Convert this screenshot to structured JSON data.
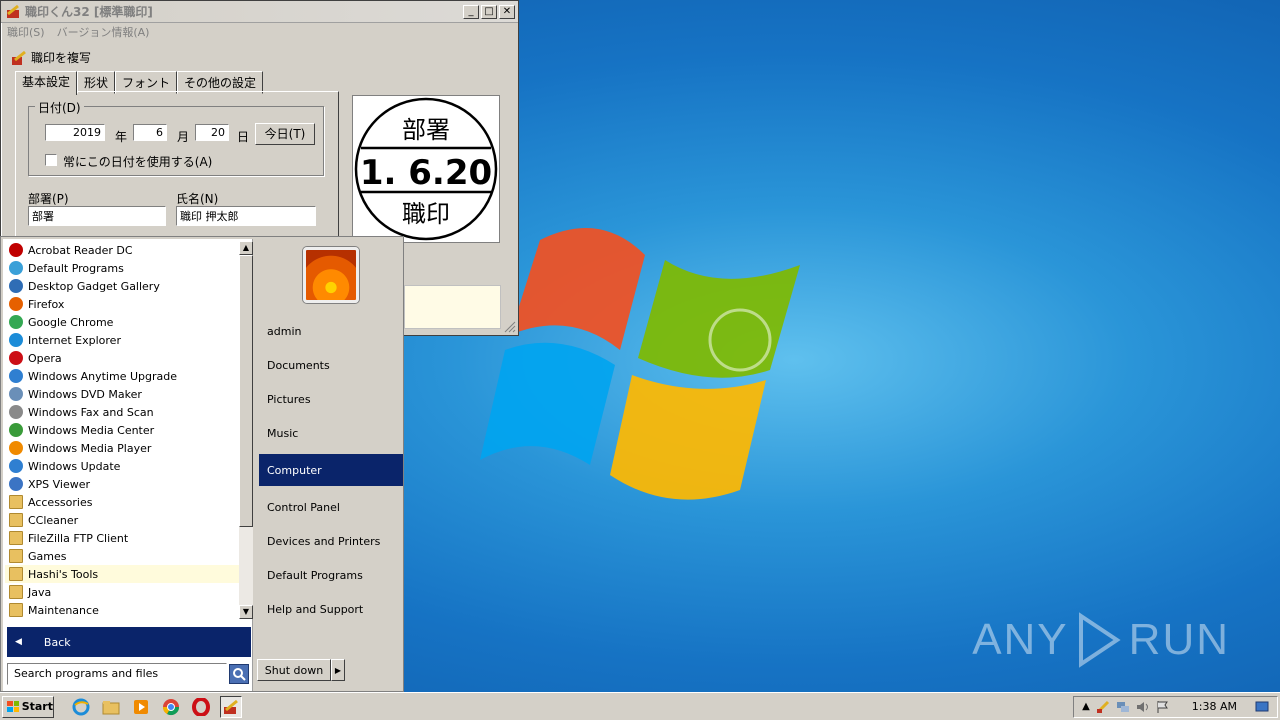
{
  "stamp_window": {
    "title": "職印くん32 [標準職印]",
    "minimize": "_",
    "maximize": "□",
    "close": "✕",
    "menu": [
      "職印(S)",
      "バージョン情報(A)"
    ],
    "copy_label": "職印を複写",
    "tabs": [
      "基本設定",
      "形状",
      "フォント",
      "その他の設定"
    ],
    "date_group_label": "日付(D)",
    "year_value": "2019",
    "year_unit": "年",
    "month_value": "6",
    "month_unit": "月",
    "day_value": "20",
    "day_unit": "日",
    "today_button": "今日(T)",
    "always_use_date": "常にこの日付を使用する(A)",
    "dept_label": "部署(P)",
    "dept_value": "部署",
    "name_label": "氏名(N)",
    "name_value": "職印 押太郎",
    "preview": {
      "top": "部署",
      "middle": "1. 6.20",
      "bottom": "職印"
    }
  },
  "start_menu": {
    "programs": [
      {
        "label": "Acrobat Reader DC",
        "icon": "acrobat-icon",
        "color": "#c00000"
      },
      {
        "label": "Default Programs",
        "icon": "default-programs-icon",
        "color": "#3aa0d8"
      },
      {
        "label": "Desktop Gadget Gallery",
        "icon": "gadget-icon",
        "color": "#2f6db5"
      },
      {
        "label": "Firefox",
        "icon": "firefox-icon",
        "color": "#e66000"
      },
      {
        "label": "Google Chrome",
        "icon": "chrome-icon",
        "color": "#34a853"
      },
      {
        "label": "Internet Explorer",
        "icon": "ie-icon",
        "color": "#1c8cd8"
      },
      {
        "label": "Opera",
        "icon": "opera-icon",
        "color": "#cc0f16"
      },
      {
        "label": "Windows Anytime Upgrade",
        "icon": "windows-upgrade-icon",
        "color": "#2f7fd1"
      },
      {
        "label": "Windows DVD Maker",
        "icon": "dvd-icon",
        "color": "#6a8fb8"
      },
      {
        "label": "Windows Fax and Scan",
        "icon": "fax-icon",
        "color": "#8a8a8a"
      },
      {
        "label": "Windows Media Center",
        "icon": "media-center-icon",
        "color": "#3a9b3a"
      },
      {
        "label": "Windows Media Player",
        "icon": "media-player-icon",
        "color": "#f08a00"
      },
      {
        "label": "Windows Update",
        "icon": "windows-update-icon",
        "color": "#2f7fd1"
      },
      {
        "label": "XPS Viewer",
        "icon": "xps-icon",
        "color": "#3b74c4"
      },
      {
        "label": "Accessories",
        "icon": "folder-icon",
        "color": "#e8c060"
      },
      {
        "label": "CCleaner",
        "icon": "folder-icon",
        "color": "#e8c060"
      },
      {
        "label": "FileZilla FTP Client",
        "icon": "folder-icon",
        "color": "#e8c060"
      },
      {
        "label": "Games",
        "icon": "folder-icon",
        "color": "#e8c060"
      },
      {
        "label": "Hashi's Tools",
        "icon": "folder-icon",
        "color": "#e8c060",
        "highlight": true
      },
      {
        "label": "Java",
        "icon": "folder-icon",
        "color": "#e8c060"
      },
      {
        "label": "Maintenance",
        "icon": "folder-icon",
        "color": "#e8c060"
      }
    ],
    "back_label": "Back",
    "search_placeholder": "Search programs and files",
    "right_items": [
      "admin",
      "Documents",
      "Pictures",
      "Music",
      "Computer",
      "Control Panel",
      "Devices and Printers",
      "Default Programs",
      "Help and Support"
    ],
    "selected_item": "Computer",
    "shutdown_label": "Shut down"
  },
  "taskbar": {
    "start_label": "Start",
    "clock": "1:38 AM"
  },
  "watermark": {
    "left": "ANY",
    "right": "RUN"
  }
}
